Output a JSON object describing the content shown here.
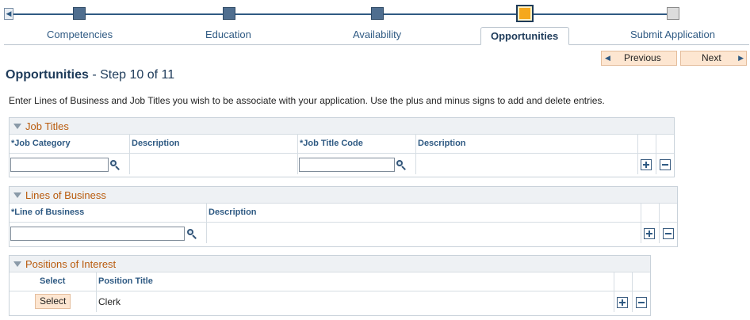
{
  "train": {
    "steps": [
      "Competencies",
      "Education",
      "Availability",
      "Opportunities",
      "Submit Application"
    ],
    "current_step": "Opportunities"
  },
  "nav": {
    "previous_label": "Previous",
    "next_label": "Next"
  },
  "page": {
    "title": "Opportunities",
    "step": "- Step 10 of 11",
    "instructions": "Enter Lines of Business and Job Titles you wish to be associate with your application. Use the plus and minus signs to add and delete entries."
  },
  "job_titles": {
    "title": "Job Titles",
    "columns": {
      "job_category": "*Job Category",
      "description1": "Description",
      "job_title_code": "*Job Title Code",
      "description2": "Description"
    },
    "rows": [
      {
        "job_category": "",
        "description1": "",
        "job_title_code": "",
        "description2": ""
      }
    ]
  },
  "lines_of_business": {
    "title": "Lines of Business",
    "columns": {
      "line_of_business": "*Line of Business",
      "description": "Description"
    },
    "rows": [
      {
        "line_of_business": "",
        "description": ""
      }
    ]
  },
  "positions": {
    "title": "Positions of Interest",
    "columns": {
      "select": "Select",
      "position_title": "Position Title"
    },
    "rows": [
      {
        "select_label": "Select",
        "position_title": "Clerk"
      }
    ]
  },
  "colors": {
    "link": "#2f5a83",
    "section_title": "#b95b0d",
    "current_step": "#f5a81c",
    "button_bg": "#fde6d1"
  },
  "icons": [
    "train-back-arrow-icon",
    "lookup-magnifier-icon",
    "add-row-icon",
    "delete-row-icon",
    "collapse-triangle-icon"
  ]
}
